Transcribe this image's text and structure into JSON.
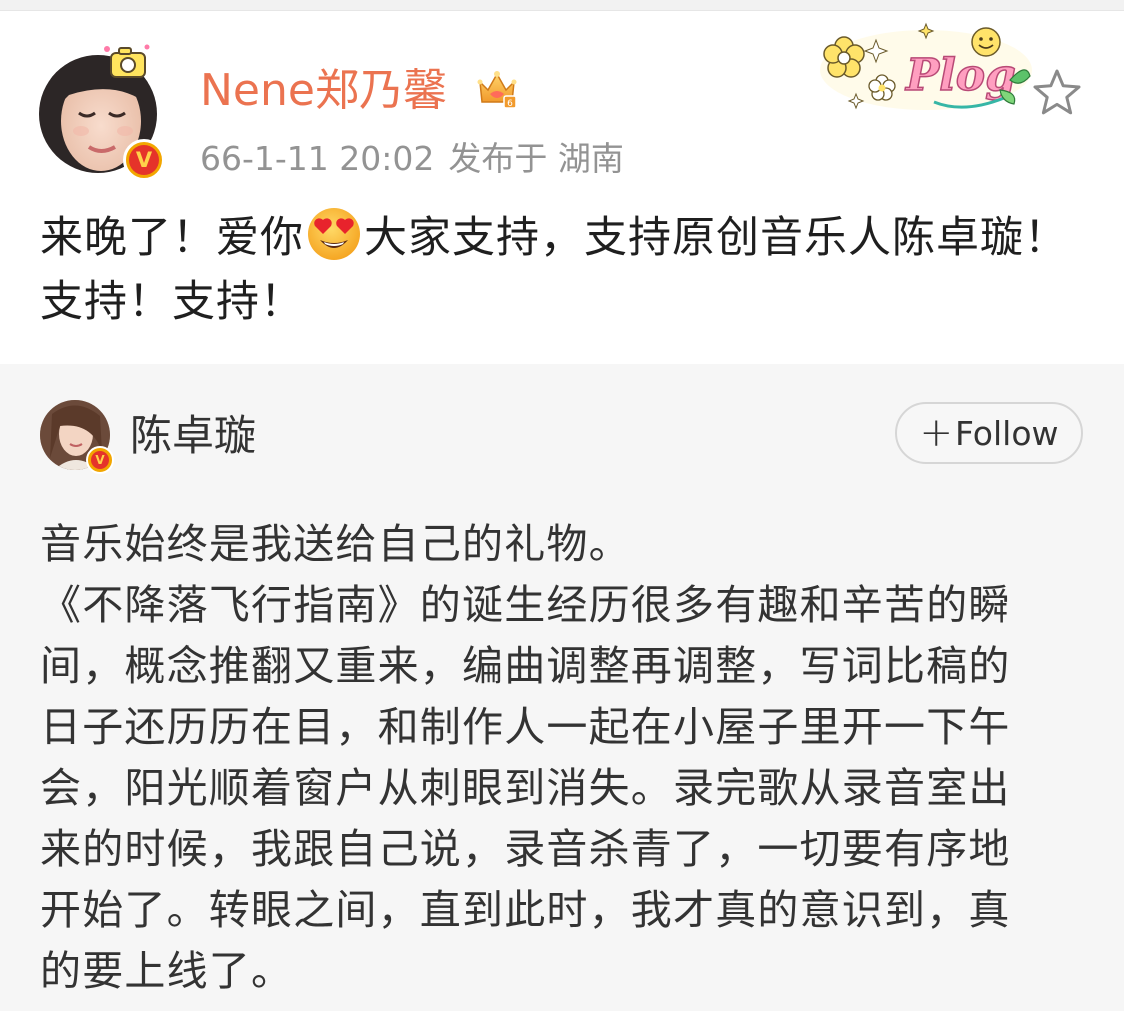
{
  "post": {
    "author": {
      "name": "Nene郑乃馨",
      "verified_badge": "V",
      "crown_icon": "crown-icon",
      "name_color": "#eb7350"
    },
    "timestamp": "66-1-11 20:02",
    "location": "发布于 湖南",
    "sticker_text": "Plog",
    "text_part1": "来晚了！爱你",
    "text_part2": "大家支持，支持原创音乐人陈卓璇！支持！支持！",
    "emoji": "heart-eyes-emoji"
  },
  "repost": {
    "author": {
      "name": "陈卓璇",
      "verified_badge": "V"
    },
    "follow_label": "Follow",
    "follow_prefix": "+",
    "paragraphs": [
      "音乐始终是我送给自己的礼物。",
      "《不降落飞行指南》的诞生经历很多有趣和辛苦的瞬间，概念推翻又重来，编曲调整再调整，写词比稿的日子还历历在目，和制作人一起在小屋子里开一下午会，阳光顺着窗户从刺眼到消失。录完歌从录音室出来的时候，我跟自己说，录音杀青了，一切要有序地开始了。转眼之间，直到此时，我才真的意识到，真的要上线了。"
    ]
  },
  "colors": {
    "accent": "#eb7350",
    "verify_gold": "#f2a600",
    "verify_red": "#e5332a",
    "repost_bg": "#f6f6f6"
  }
}
